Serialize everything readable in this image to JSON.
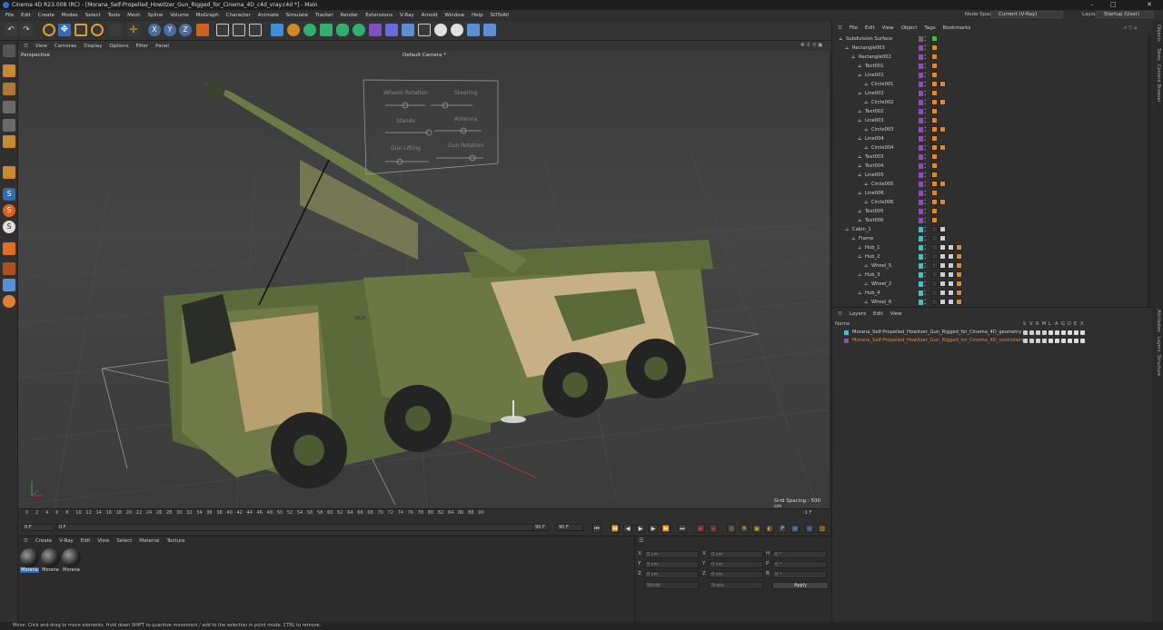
{
  "window": {
    "title": "Cinema 4D R23.008 (RC) - [Morana_Self-Propelled_Howitzer_Gun_Rigged_for_Cinema_4D_c4d_vray.c4d *] - Main",
    "controls": [
      "–",
      "□",
      "✕"
    ]
  },
  "menubar": {
    "items": [
      "File",
      "Edit",
      "Create",
      "Modes",
      "Select",
      "Tools",
      "Mesh",
      "Spline",
      "Volume",
      "MoGraph",
      "Character",
      "Animate",
      "Simulate",
      "Tracker",
      "Render",
      "Extensions",
      "V-Ray",
      "Arnold",
      "Window",
      "Help",
      "SOToAll"
    ],
    "node_space_label": "Node Space:",
    "node_space_value": "Current (V-Ray)",
    "layout_label": "Layout:",
    "layout_value": "Startup (User)"
  },
  "viewport": {
    "menu": [
      "View",
      "Cameras",
      "Display",
      "Options",
      "Filter",
      "Panel"
    ],
    "view_name": "Perspective",
    "camera_name": "Default Camera *",
    "grid_spacing": "Grid Spacing : 500 cm",
    "rig_labels": {
      "wheels_rotation": "Wheels Rotation",
      "steering": "Steering",
      "stands": "Stands",
      "antenna": "Antenna",
      "gun_lifting": "Gun Lifting",
      "gun_rotation": "Gun Rotation"
    },
    "truck_number": "5825"
  },
  "timeline": {
    "ticks": [
      "0",
      "2",
      "4",
      "6",
      "8",
      "10",
      "12",
      "14",
      "16",
      "18",
      "20",
      "22",
      "24",
      "26",
      "28",
      "30",
      "32",
      "34",
      "36",
      "38",
      "40",
      "42",
      "44",
      "46",
      "48",
      "50",
      "52",
      "54",
      "56",
      "58",
      "60",
      "62",
      "64",
      "66",
      "68",
      "70",
      "72",
      "74",
      "76",
      "78",
      "80",
      "82",
      "84",
      "86",
      "88",
      "90"
    ],
    "end_frame_display": "-1 F"
  },
  "playbar": {
    "current_frame": "0 F",
    "start_frame": "0 F",
    "end_frame": "90 F",
    "end_frame2": "90 F"
  },
  "materials": {
    "menu": [
      "Create",
      "V-Ray",
      "Edit",
      "View",
      "Select",
      "Material",
      "Texture"
    ],
    "items": [
      "Morana",
      "Morana",
      "Morana"
    ]
  },
  "coordinates": {
    "rows": [
      {
        "axis": "X",
        "pos": "0 cm",
        "axis2": "X",
        "size": "0 cm",
        "axis3": "H",
        "rot": "0 °"
      },
      {
        "axis": "Y",
        "pos": "0 cm",
        "axis2": "Y",
        "size": "0 cm",
        "axis3": "P",
        "rot": "0 °"
      },
      {
        "axis": "Z",
        "pos": "0 cm",
        "axis2": "Z",
        "size": "0 cm",
        "axis3": "B",
        "rot": "0 °"
      }
    ],
    "mode_world": "World",
    "mode_scale": "Scale",
    "apply_label": "Apply"
  },
  "objects": {
    "menu": [
      "File",
      "Edit",
      "View",
      "Object",
      "Tags",
      "Bookmarks"
    ],
    "rows": [
      {
        "name": "Subdivision Surface",
        "indent": 0,
        "color": "#6a6a6a",
        "tags": "check"
      },
      {
        "name": "Rectangle003",
        "indent": 1,
        "color": "#a040d0",
        "tags": "o"
      },
      {
        "name": "Rectangle002",
        "indent": 2,
        "color": "#a040d0",
        "tags": "o"
      },
      {
        "name": "Text001",
        "indent": 3,
        "color": "#a040d0",
        "tags": "o"
      },
      {
        "name": "Line001",
        "indent": 3,
        "color": "#a040d0",
        "tags": "o"
      },
      {
        "name": "Circle001",
        "indent": 4,
        "color": "#a040d0",
        "tags": "oo"
      },
      {
        "name": "Line002",
        "indent": 3,
        "color": "#a040d0",
        "tags": "o"
      },
      {
        "name": "Circle002",
        "indent": 4,
        "color": "#a040d0",
        "tags": "oo"
      },
      {
        "name": "Text002",
        "indent": 3,
        "color": "#a040d0",
        "tags": "o"
      },
      {
        "name": "Line003",
        "indent": 3,
        "color": "#a040d0",
        "tags": "o"
      },
      {
        "name": "Circle003",
        "indent": 4,
        "color": "#a040d0",
        "tags": "oo"
      },
      {
        "name": "Line004",
        "indent": 3,
        "color": "#a040d0",
        "tags": "o"
      },
      {
        "name": "Circle004",
        "indent": 4,
        "color": "#a040d0",
        "tags": "oo"
      },
      {
        "name": "Text003",
        "indent": 3,
        "color": "#a040d0",
        "tags": "o"
      },
      {
        "name": "Text004",
        "indent": 3,
        "color": "#a040d0",
        "tags": "o"
      },
      {
        "name": "Line005",
        "indent": 3,
        "color": "#a040d0",
        "tags": "o"
      },
      {
        "name": "Circle005",
        "indent": 4,
        "color": "#a040d0",
        "tags": "oo"
      },
      {
        "name": "Line006",
        "indent": 3,
        "color": "#a040d0",
        "tags": "o"
      },
      {
        "name": "Circle006",
        "indent": 4,
        "color": "#a040d0",
        "tags": "oo"
      },
      {
        "name": "Text005",
        "indent": 3,
        "color": "#a040d0",
        "tags": "o"
      },
      {
        "name": "Text006",
        "indent": 3,
        "color": "#a040d0",
        "tags": "o"
      },
      {
        "name": "Cabin_1",
        "indent": 1,
        "color": "#30c8c8",
        "tags": "mesh"
      },
      {
        "name": "Frame",
        "indent": 2,
        "color": "#30c8c8",
        "tags": "mesh"
      },
      {
        "name": "Hub_1",
        "indent": 3,
        "color": "#30c8c8",
        "tags": "meshx"
      },
      {
        "name": "Hub_2",
        "indent": 3,
        "color": "#30c8c8",
        "tags": "meshx"
      },
      {
        "name": "Wheel_5",
        "indent": 4,
        "color": "#30c8c8",
        "tags": "meshx"
      },
      {
        "name": "Hub_3",
        "indent": 3,
        "color": "#30c8c8",
        "tags": "meshx"
      },
      {
        "name": "Wheel_2",
        "indent": 4,
        "color": "#30c8c8",
        "tags": "meshx"
      },
      {
        "name": "Hub_4",
        "indent": 3,
        "color": "#30c8c8",
        "tags": "meshx"
      },
      {
        "name": "Wheel_6",
        "indent": 4,
        "color": "#30c8c8",
        "tags": "meshx"
      }
    ]
  },
  "layers": {
    "menu": [
      "Layers",
      "Edit",
      "View"
    ],
    "header_name": "Name",
    "header_flags": [
      "S",
      "V",
      "R",
      "M",
      "L",
      "A",
      "G",
      "D",
      "E",
      "X"
    ],
    "rows": [
      {
        "name": "Morana_Self-Propelled_Howitzer_Gun_Rigged_for_Cinema_4D_geometry",
        "color": "#30c8c8",
        "text_color": "#d0d0d0"
      },
      {
        "name": "Morana_Self-Propelled_Howitzer_Gun_Rigged_for_Cinema_4D_controllers",
        "color": "#a040d0",
        "text_color": "#e08a30"
      }
    ]
  },
  "right_tabs": [
    "Objects",
    "Takes",
    "Content Browser",
    "Attributes",
    "Layers",
    "Structure"
  ],
  "status": {
    "text": "Move: Click and drag to move elements. Hold down SHIFT to quantize movement / add to the selection in point mode, CTRL to remove."
  }
}
